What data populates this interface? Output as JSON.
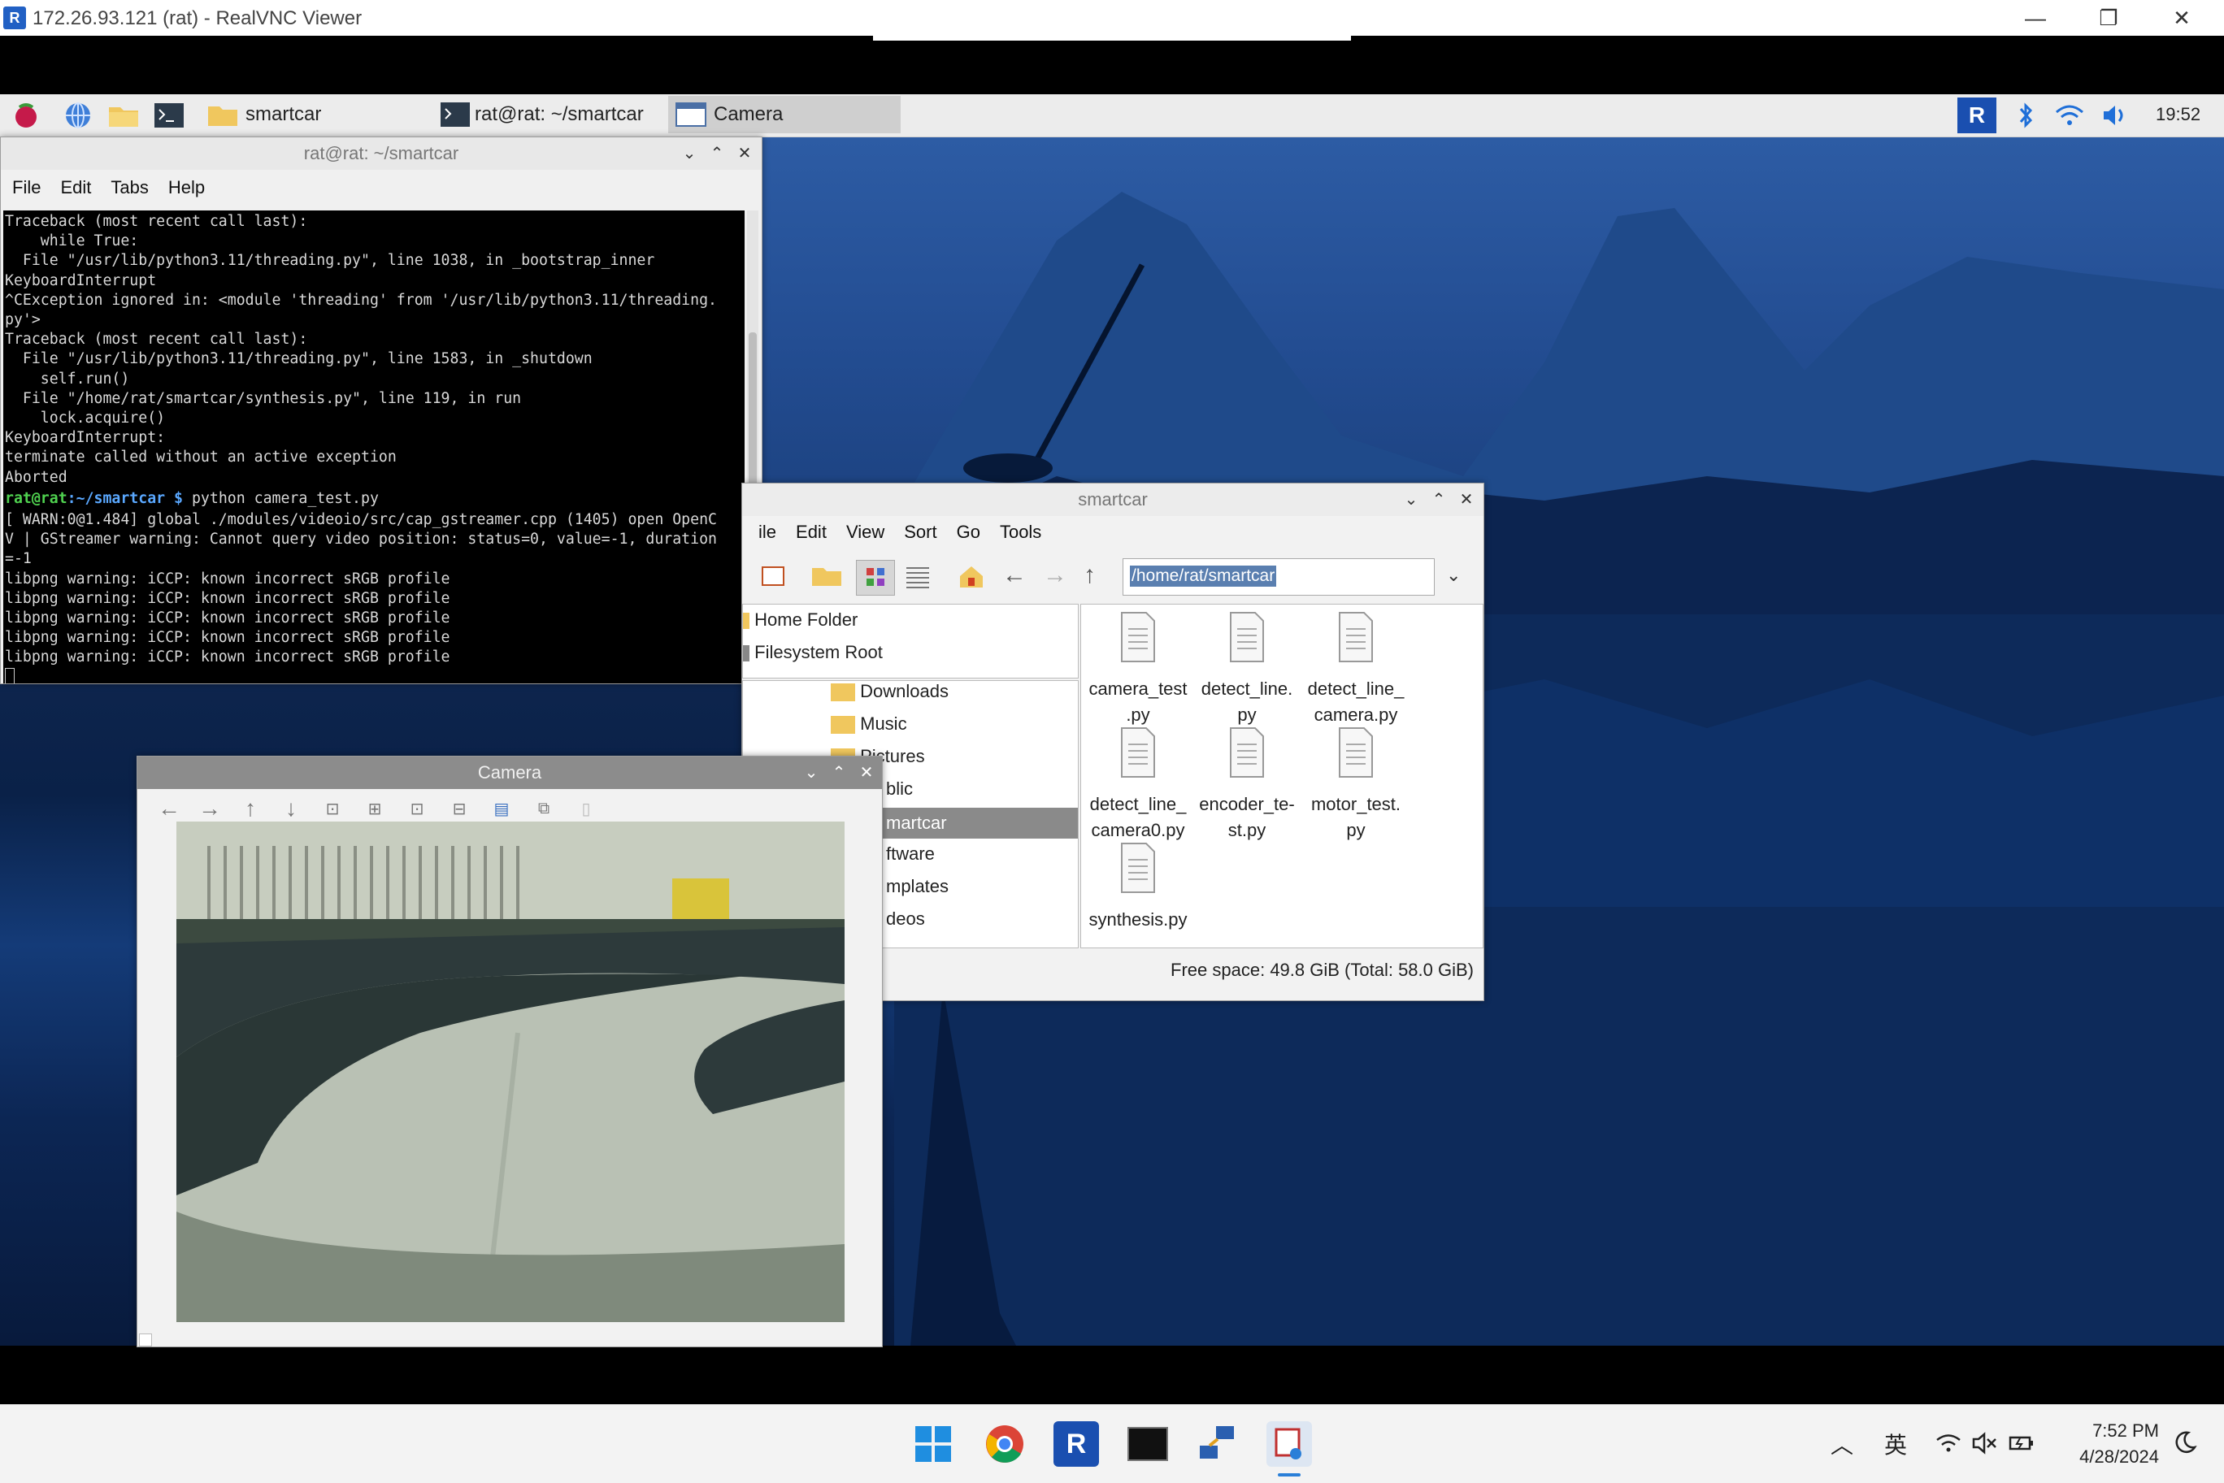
{
  "vnc": {
    "title": "172.26.93.121 (rat) - RealVNC Viewer",
    "logo_text": "R",
    "minimize": "—",
    "restore": "❐",
    "close": "✕"
  },
  "panel": {
    "tasks": [
      {
        "label": "smartcar"
      },
      {
        "label": "rat@rat: ~/smartcar"
      },
      {
        "label": "Camera"
      }
    ],
    "clock": "19:52"
  },
  "terminal": {
    "title": "rat@rat: ~/smartcar",
    "menu": [
      "File",
      "Edit",
      "Tabs",
      "Help"
    ],
    "lines_before": [
      "Traceback (most recent call last):",
      "    while True:",
      "  File \"/usr/lib/python3.11/threading.py\", line 1038, in _bootstrap_inner",
      "KeyboardInterrupt",
      "^CException ignored in: <module 'threading' from '/usr/lib/python3.11/threading.",
      "py'>",
      "Traceback (most recent call last):",
      "  File \"/usr/lib/python3.11/threading.py\", line 1583, in _shutdown",
      "    self.run()",
      "  File \"/home/rat/smartcar/synthesis.py\", line 119, in run",
      "    lock.acquire()",
      "KeyboardInterrupt:",
      "terminate called without an active exception",
      "Aborted"
    ],
    "prompt_user": "rat@rat",
    "prompt_path": ":~/smartcar $",
    "command": " python camera_test.py",
    "lines_after": [
      "[ WARN:0@1.484] global ./modules/videoio/src/cap_gstreamer.cpp (1405) open OpenC",
      "V | GStreamer warning: Cannot query video position: status=0, value=-1, duration",
      "=-1",
      "libpng warning: iCCP: known incorrect sRGB profile",
      "libpng warning: iCCP: known incorrect sRGB profile",
      "libpng warning: iCCP: known incorrect sRGB profile",
      "libpng warning: iCCP: known incorrect sRGB profile",
      "libpng warning: iCCP: known incorrect sRGB profile"
    ]
  },
  "filemanager": {
    "title": "smartcar",
    "menu": [
      "ile",
      "Edit",
      "View",
      "Sort",
      "Go",
      "Tools"
    ],
    "path": "/home/rat/smartcar",
    "places": [
      "Home Folder",
      "Filesystem Root"
    ],
    "tree": [
      "Downloads",
      "Music",
      "Pictures",
      "blic",
      "martcar",
      "ftware",
      "mplates",
      "deos"
    ],
    "files": [
      {
        "line1": "camera_test",
        "line2": ".py"
      },
      {
        "line1": "detect_line.",
        "line2": "py"
      },
      {
        "line1": "detect_line_",
        "line2": "camera.py"
      },
      {
        "line1": "detect_line_",
        "line2": "camera0.py"
      },
      {
        "line1": "encoder_te-",
        "line2": "st.py"
      },
      {
        "line1": "motor_test.",
        "line2": "py"
      },
      {
        "line1": "synthesis.py",
        "line2": ""
      }
    ],
    "status": "Free space: 49.8 GiB (Total: 58.0 GiB)"
  },
  "camera": {
    "title": "Camera"
  },
  "windows_taskbar": {
    "ime": "英",
    "time": "7:52 PM",
    "date": "4/28/2024"
  },
  "colors": {
    "desktop_blue": "#1a3e7a",
    "prompt_green": "#4fd14f",
    "prompt_blue": "#5aa8ff"
  }
}
